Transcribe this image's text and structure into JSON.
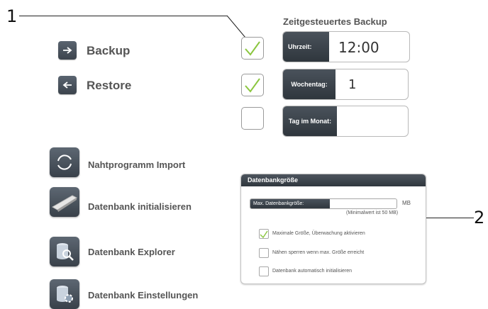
{
  "callouts": {
    "one": "1",
    "two": "2"
  },
  "backup_menu": {
    "backup_label": "Backup",
    "restore_label": "Restore"
  },
  "scheduled_backup": {
    "title": "Zeitgesteuertes Backup",
    "time": {
      "label": "Uhrzeit:",
      "value": "12:00",
      "enabled": true
    },
    "weekday": {
      "label": "Wochentag:",
      "value": "1",
      "enabled": true
    },
    "day_of_month": {
      "label": "Tag im Monat:",
      "value": "",
      "enabled": false
    }
  },
  "database_menu": {
    "import_label": "Nahtprogramm Import",
    "init_label": "Datenbank initialisieren",
    "explorer_label": "Datenbank Explorer",
    "settings_label": "Datenbank Einstellungen"
  },
  "db_size_panel": {
    "title": "Datenbankgröße",
    "max_size_label": "Max. Datenbankgröße:",
    "max_size_value": "",
    "unit": "MB",
    "min_hint": "(Minimalwert ist 50 MB)",
    "options": [
      {
        "label": "Maximale Größe, Überwachung aktivieren",
        "checked": true
      },
      {
        "label": "Nähen sperren wenn max. Größe erreicht",
        "checked": false
      },
      {
        "label": "Datenbank automatisch initialisieren",
        "checked": false
      }
    ]
  },
  "colors": {
    "check": "#8bc63f",
    "button_dark": "#3c444d",
    "label_gray": "#555555"
  },
  "icons": [
    "arrow-right-icon",
    "arrow-left-icon",
    "sync-icon",
    "sewing-machine-icon",
    "database-search-icon",
    "database-settings-icon",
    "checkmark-icon"
  ]
}
